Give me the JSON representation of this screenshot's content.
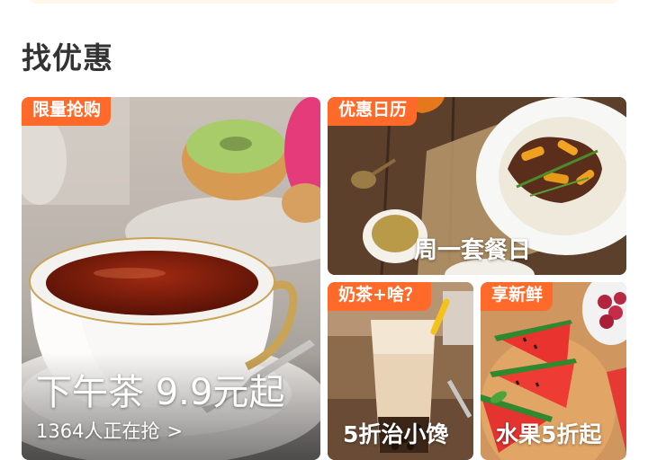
{
  "section": {
    "title": "找优惠"
  },
  "cards": {
    "afternoon_tea": {
      "tag": "限量抢购",
      "title": "下午茶 9.9元起",
      "subtitle": "1364人正在抢",
      "chevron": ">",
      "tag_color": "#ff6a2a"
    },
    "calendar": {
      "tag": "优惠日历",
      "title": "周一套餐日"
    },
    "milk_tea": {
      "tag": "奶茶+啥？",
      "title": "5折治小馋"
    },
    "fruit": {
      "tag": "享新鲜",
      "title": "水果5折起"
    }
  }
}
